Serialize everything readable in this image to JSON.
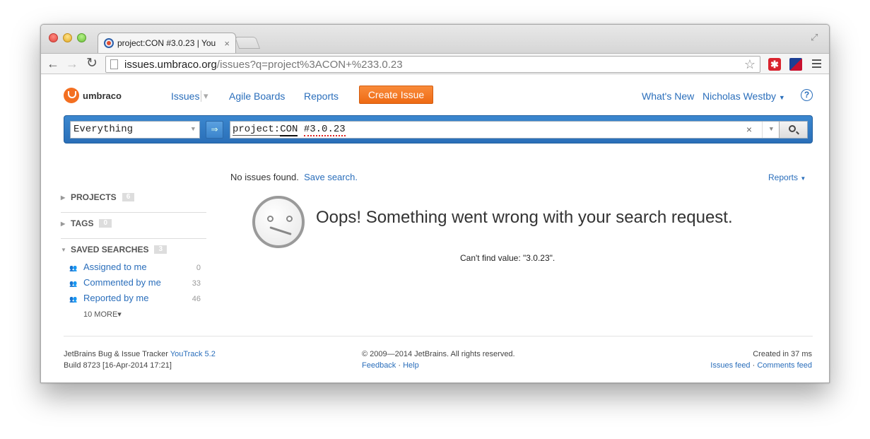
{
  "browser": {
    "tab_title": "project:CON #3.0.23 | You",
    "tab_close": "×",
    "url_host": "issues.umbraco.org",
    "url_path": "/issues?q=project%3ACON+%233.0.23"
  },
  "nav": {
    "logo_text": "umbraco",
    "issues": "Issues",
    "agile_boards": "Agile Boards",
    "reports": "Reports",
    "create_issue": "Create Issue",
    "whats_new": "What's New",
    "user": "Nicholas Westby",
    "help": "?"
  },
  "search": {
    "context": "Everything",
    "query_key": "project:",
    "query_project": "CON",
    "query_space": " ",
    "query_version": "#3.0.23"
  },
  "status": {
    "no_issues": "No issues found.",
    "save_search": "Save search.",
    "reports": "Reports"
  },
  "sidebar": {
    "projects_label": "PROJECTS",
    "projects_count": "6",
    "tags_label": "TAGS",
    "tags_count": "0",
    "saved_label": "SAVED SEARCHES",
    "saved_count": "3",
    "saved_items": [
      {
        "label": "Assigned to me",
        "count": "0"
      },
      {
        "label": "Commented by me",
        "count": "33"
      },
      {
        "label": "Reported by me",
        "count": "46"
      }
    ],
    "more": "10 MORE▾"
  },
  "message": {
    "title": "Oops! Something went wrong with your search request.",
    "detail": "Can't find value: \"3.0.23\"."
  },
  "footer": {
    "tracker_text": "JetBrains Bug & Issue Tracker ",
    "tracker_link": "YouTrack 5.2",
    "build": "Build 8723 [16-Apr-2014 17:21]",
    "copyright": "© 2009—2014 JetBrains. All rights reserved.",
    "feedback": "Feedback",
    "sep": " · ",
    "help": "Help",
    "created": "Created in 37 ms",
    "issues_feed": "Issues feed",
    "comments_feed": "Comments feed"
  },
  "colors": {
    "accent": "#2a6ebb",
    "create_button": "#f47b20",
    "searchbar": "#3378c4"
  }
}
